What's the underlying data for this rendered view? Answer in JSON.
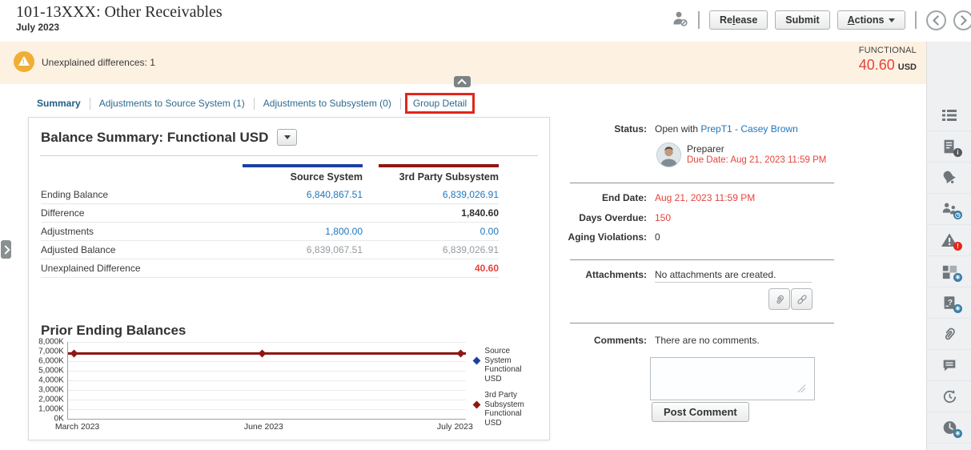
{
  "header": {
    "title": "101-13XXX: Other Receivables",
    "period": "July 2023",
    "buttons": {
      "release_pre": "Re",
      "release_mnemonic": "l",
      "release_post": "ease",
      "submit": "Submit",
      "actions_mnemonic": "A",
      "actions_post": "ctions"
    }
  },
  "banner": {
    "warning": "Unexplained differences: 1",
    "currency_type": "FUNCTIONAL",
    "amount": "40.60",
    "currency": "USD"
  },
  "tabs": {
    "items": [
      {
        "label": "Summary",
        "active": true
      },
      {
        "label": "Adjustments to Source System (1)"
      },
      {
        "label": "Adjustments to Subsystem (0)"
      },
      {
        "label": "Group Detail",
        "highlighted": true
      }
    ]
  },
  "balance_summary": {
    "title": "Balance Summary: Functional USD",
    "columns": [
      "Source System",
      "3rd Party Subsystem"
    ],
    "rows": [
      {
        "label": "Ending Balance",
        "source": "6,840,867.51",
        "subsystem": "6,839,026.91"
      },
      {
        "label": "Difference",
        "source": "",
        "subsystem": "1,840.60"
      },
      {
        "label": "Adjustments",
        "source": "1,800.00",
        "subsystem": "0.00"
      },
      {
        "label": "Adjusted Balance",
        "source": "6,839,067.51",
        "subsystem": "6,839,026.91"
      },
      {
        "label": "Unexplained Difference",
        "source": "",
        "subsystem": "40.60"
      }
    ]
  },
  "chart_data": {
    "type": "line",
    "title": "Prior Ending Balances",
    "x": [
      "March 2023",
      "June 2023",
      "July 2023"
    ],
    "series": [
      {
        "name": "Source System Functional USD",
        "color": "#1b3fa3",
        "values_thousands": [
          6841,
          6841,
          6841
        ]
      },
      {
        "name": "3rd Party Subsystem Functional USD",
        "color": "#8e1713",
        "values_thousands": [
          6839,
          6839,
          6839
        ]
      }
    ],
    "yticks": [
      "8,000K",
      "7,000K",
      "6,000K",
      "5,000K",
      "4,000K",
      "3,000K",
      "2,000K",
      "1,000K",
      "0K"
    ],
    "ylim_thousands": [
      0,
      8000
    ],
    "grid": true,
    "legend_position": "right"
  },
  "status_panel": {
    "status_label": "Status:",
    "status_prefix": "Open with ",
    "status_link": "PrepT1 - Casey Brown",
    "role": "Preparer",
    "due_date": "Due Date:  Aug 21, 2023 11:59 PM",
    "fields": [
      {
        "label": "End Date:",
        "value": "Aug 21, 2023 11:59 PM"
      },
      {
        "label": "Days Overdue:",
        "value": "150"
      },
      {
        "label": "Aging Violations:",
        "value": "0"
      }
    ],
    "attachments_label": "Attachments:",
    "attachments_empty": "No attachments are created.",
    "comments_label": "Comments:",
    "comments_empty": "There are no comments.",
    "post_comment": "Post Comment"
  },
  "right_rail": {
    "icons": [
      "task-list",
      "report-info",
      "alerts",
      "workflow-users",
      "warnings",
      "summary-tiles",
      "questions",
      "attachments",
      "comments",
      "history",
      "time"
    ]
  },
  "colors": {
    "banner_bg": "#fdf1e1",
    "alert_red": "#e5443c",
    "link_blue": "#1f77bd",
    "source_system_bar": "#1b3fa3",
    "subsystem_bar": "#8e1713",
    "annotation_red": "#e1261d"
  }
}
